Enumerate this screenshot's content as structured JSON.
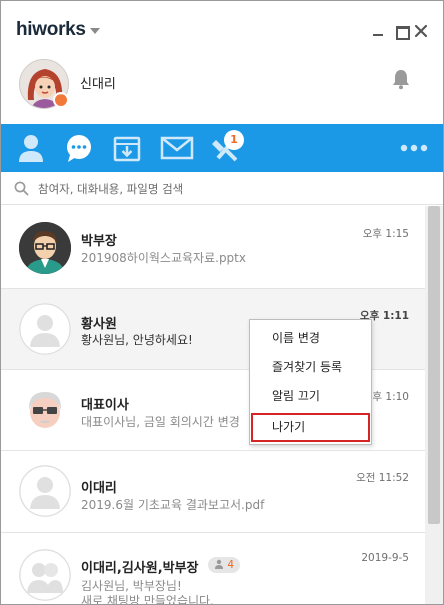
{
  "app": {
    "logo_text": "hiworks"
  },
  "profile": {
    "name": "신대리"
  },
  "nav": {
    "badge_count": "1",
    "items": [
      "people-icon",
      "chat-icon",
      "inbox-icon",
      "mail-icon",
      "tools-icon",
      "more-icon"
    ]
  },
  "search": {
    "placeholder": "참여자, 대화내용, 파일명 검색"
  },
  "chats": [
    {
      "name": "박부장",
      "preview": "201908하이웍스교육자료.pptx",
      "time": "오후 1:15",
      "unread": false
    },
    {
      "name": "황사원",
      "preview": "황사원님, 안녕하세요!",
      "time": "오후 1:11",
      "unread": true
    },
    {
      "name": "대표이사",
      "preview": "대표이사님, 금일 회의시간 변경",
      "time": "오후 1:10",
      "unread": false
    },
    {
      "name": "이대리",
      "preview": "2019.6월 기초교육 결과보고서.pdf",
      "time": "오전 11:52",
      "unread": false
    },
    {
      "name": "이대리,김사원,박부장",
      "preview": "김사원님, 박부장님!",
      "preview2": "새로 채팅방 만들었습니다.",
      "time": "2019-9-5",
      "member_count": "4",
      "unread": false
    }
  ],
  "context_menu": {
    "items": [
      "이름 변경",
      "즐겨찾기 등록",
      "알림 끄기",
      "나가기"
    ],
    "highlighted": "나가기"
  },
  "colors": {
    "nav_bg": "#1c99e6",
    "accent_orange": "#ef6a22",
    "highlight_border": "#d62525"
  }
}
